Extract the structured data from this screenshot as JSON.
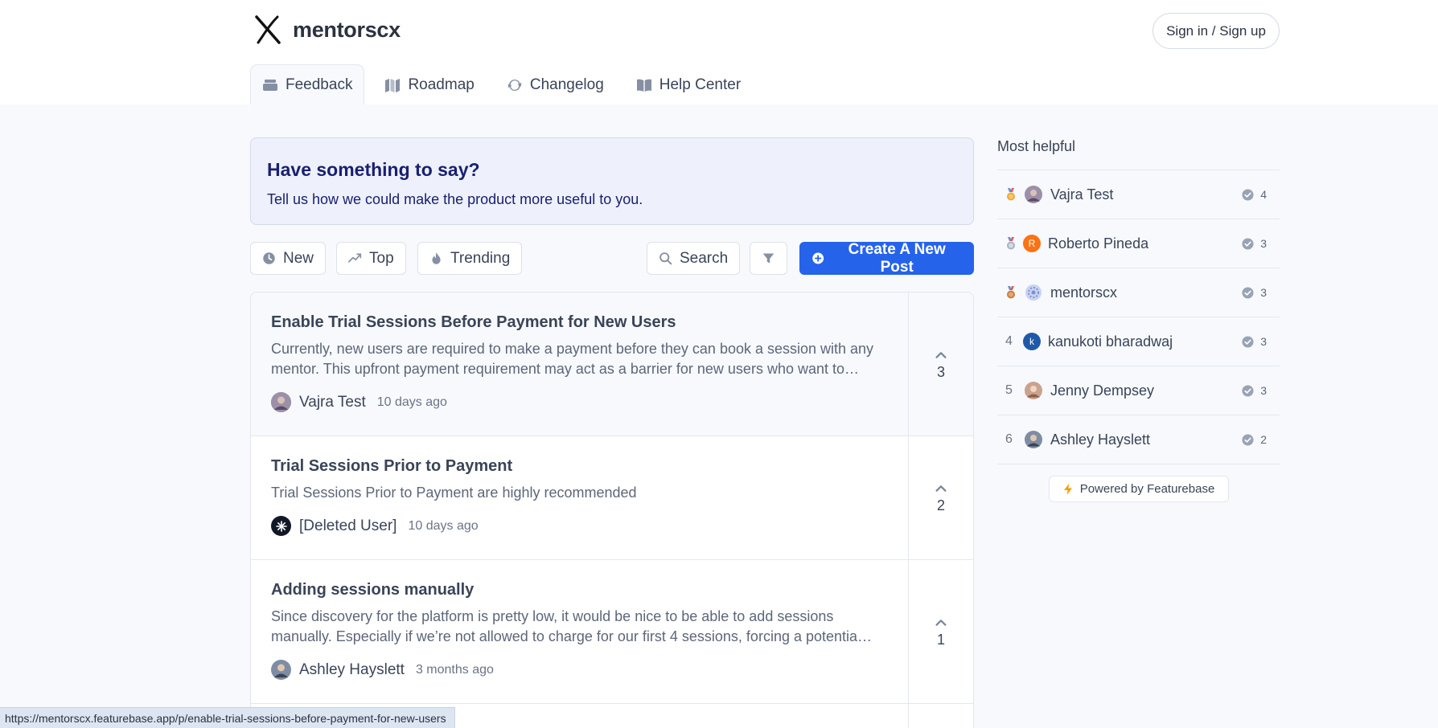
{
  "app": {
    "name": "mentorscx",
    "signin_label": "Sign in / Sign up"
  },
  "tabs": [
    {
      "label": "Feedback",
      "icon": "feedback-icon",
      "active": true
    },
    {
      "label": "Roadmap",
      "icon": "roadmap-icon",
      "active": false
    },
    {
      "label": "Changelog",
      "icon": "changelog-icon",
      "active": false
    },
    {
      "label": "Help Center",
      "icon": "help-book-icon",
      "active": false
    }
  ],
  "hero": {
    "title": "Have something to say?",
    "subtitle": "Tell us how we could make the product more useful to you."
  },
  "toolbar": {
    "new_label": "New",
    "top_label": "Top",
    "trending_label": "Trending",
    "search_label": "Search",
    "create_label": "Create A New Post"
  },
  "posts": [
    {
      "title": "Enable Trial Sessions Before Payment for New Users",
      "description": "Currently, new users are required to make a payment before they can book a session with any mentor. This upfront payment requirement may act as a barrier for new users who want to…",
      "author": "Vajra Test",
      "time": "10 days ago",
      "votes": "3"
    },
    {
      "title": "Trial Sessions Prior to Payment",
      "description": "Trial Sessions Prior to Payment are highly recommended",
      "author": "[Deleted User]",
      "time": "10 days ago",
      "votes": "2"
    },
    {
      "title": "Adding sessions manually",
      "description": "Since discovery for the platform is pretty low, it would be nice to be able to add sessions manually. Especially if we’re not allowed to charge for our first 4 sessions, forcing a potentia…",
      "author": "Ashley Hayslett",
      "time": "3 months ago",
      "votes": "1"
    }
  ],
  "sidebar": {
    "title": "Most helpful",
    "leaders": [
      {
        "rank": "",
        "medal": "gold",
        "name": "Vajra Test",
        "score": "4"
      },
      {
        "rank": "",
        "medal": "silver",
        "name": "Roberto Pineda",
        "score": "3",
        "initial": "R"
      },
      {
        "rank": "",
        "medal": "bronze",
        "name": "mentorscx",
        "score": "3"
      },
      {
        "rank": "4",
        "name": "kanukoti bharadwaj",
        "score": "3",
        "initial": "k"
      },
      {
        "rank": "5",
        "name": "Jenny Dempsey",
        "score": "3"
      },
      {
        "rank": "6",
        "name": "Ashley Hayslett",
        "score": "2"
      }
    ],
    "powered_by": "Powered by Featurebase"
  },
  "status_url": "https://mentorscx.featurebase.app/p/enable-trial-sessions-before-payment-for-new-users",
  "colors": {
    "accent": "#2563eb",
    "hero_title": "#1a2070"
  }
}
